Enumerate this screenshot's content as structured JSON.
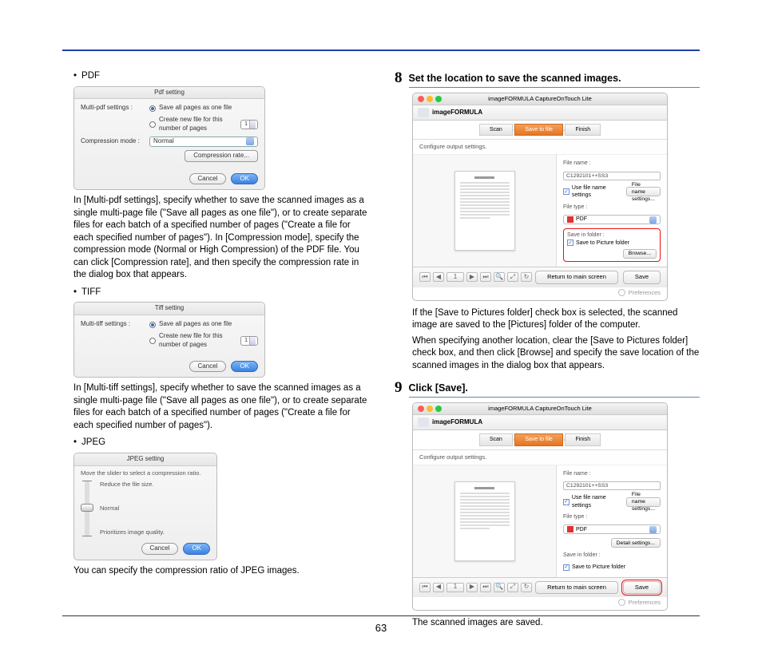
{
  "page_number": "63",
  "left": {
    "pdf": {
      "bullet": "PDF",
      "dialog": {
        "title": "Pdf setting",
        "row1_label": "Multi-pdf settings :",
        "radio1": "Save all pages as one file",
        "radio2": "Create new file for this number of pages",
        "spin_value": "1",
        "row2_label": "Compression mode :",
        "select_value": "Normal",
        "btn_rate": "Compression rate...",
        "btn_cancel": "Cancel",
        "btn_ok": "OK"
      },
      "text": "In [Multi-pdf settings], specify whether to save the scanned images as a single multi-page file (\"Save all pages as one file\"), or to create separate files for each batch of a specified number of pages (\"Create a file for each specified number of pages\"). In [Compression mode], specify the compression mode (Normal or High Compression) of the PDF file. You can click [Compression rate], and then specify the compression rate in the dialog box that appears."
    },
    "tiff": {
      "bullet": "TIFF",
      "dialog": {
        "title": "Tiff setting",
        "row1_label": "Multi-tiff settings :",
        "radio1": "Save all pages as one file",
        "radio2": "Create new file for this number of pages",
        "spin_value": "1",
        "btn_cancel": "Cancel",
        "btn_ok": "OK"
      },
      "text": "In [Multi-tiff settings], specify whether to save the scanned images as a single multi-page file (\"Save all pages as one file\"), or to create separate files for each batch of a specified number of pages (\"Create a file for each specified number of pages\")."
    },
    "jpeg": {
      "bullet": "JPEG",
      "dialog": {
        "title": "JPEG setting",
        "instr": "Move the slider to select a compression ratio.",
        "top": "Reduce the file size.",
        "mid": "Normal",
        "bot": "Prioritizes image quality.",
        "btn_cancel": "Cancel",
        "btn_ok": "OK"
      },
      "text": "You can specify the compression ratio of JPEG images."
    }
  },
  "right": {
    "step8": {
      "num": "8",
      "title": "Set the location to save the scanned images.",
      "text1": "If the [Save to Pictures folder] check box is selected, the scanned image are saved to the [Pictures] folder of the computer.",
      "text2": "When specifying another location, clear the [Save to Pictures folder] check box, and then click [Browse] and specify the save location of the scanned images in the dialog box that appears."
    },
    "step9": {
      "num": "9",
      "title": "Click [Save].",
      "text": "The scanned images are saved."
    },
    "app": {
      "title": "imageFORMULA CaptureOnTouch Lite",
      "brand": "imageFORMULA",
      "step_scan": "Scan",
      "step_save": "Save to file",
      "step_finish": "Finish",
      "configure": "Configure output settings.",
      "file_name_label": "File name :",
      "file_name_value": "C1292101++SS3",
      "use_filename": "Use file name settings",
      "filename_btn": "File name settings...",
      "file_type_label": "File type :",
      "file_type_value": "PDF",
      "detail_btn": "Detail settings...",
      "save_in_label": "Save in folder :",
      "save_to_pictures": "Save to Picture folder",
      "browse_btn": "Browse...",
      "return_btn": "Return to main screen",
      "save_btn": "Save",
      "preferences": "Preferences"
    }
  }
}
